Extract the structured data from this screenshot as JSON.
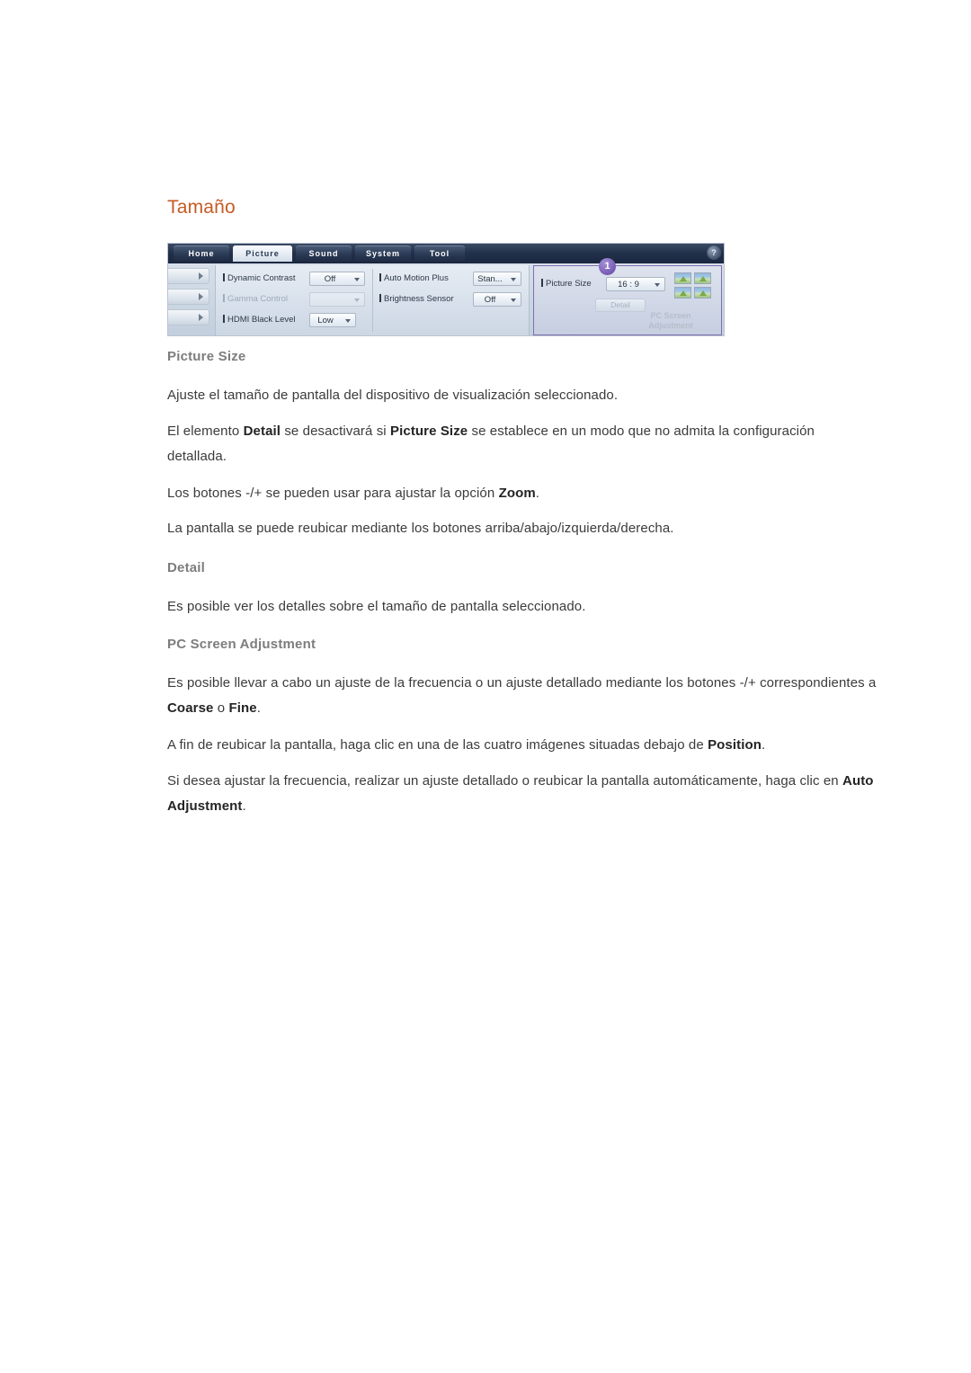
{
  "document": {
    "title": "Tamaño"
  },
  "osd": {
    "tabs": [
      {
        "label": "Home",
        "active": false
      },
      {
        "label": "Picture",
        "active": true
      },
      {
        "label": "Sound",
        "active": false
      },
      {
        "label": "System",
        "active": false
      },
      {
        "label": "Tool",
        "active": false
      }
    ],
    "help_icon": "?",
    "rail_buttons": [
      "chevron-right-icon",
      "chevron-right-icon",
      "chevron-right-icon"
    ],
    "settings_left": [
      {
        "label": "Dynamic Contrast",
        "value": "Off",
        "disabled": false
      },
      {
        "label": "Gamma Control",
        "value": "",
        "disabled": true
      },
      {
        "label": "HDMI Black Level",
        "value": "Low",
        "disabled": false
      }
    ],
    "settings_middle": [
      {
        "label": "Auto Motion Plus",
        "value": "Stan...",
        "disabled": false
      },
      {
        "label": "Brightness Sensor",
        "value": "Off",
        "disabled": false
      }
    ],
    "panel": {
      "badge": "1",
      "picture_size_label": "Picture Size",
      "picture_size_value": "16 : 9",
      "detail_button": "Detail",
      "pc_screen_label": "PC Screen\nAdjustment",
      "pc_screen_line1": "PC Screen",
      "pc_screen_line2": "Adjustment",
      "highlight_color": "#7e6fb0"
    }
  },
  "content": {
    "heading_picture_size": "Picture Size",
    "p_picture_size_1": "Ajuste el tamaño de pantalla del dispositivo de visualización seleccionado.",
    "p_picture_size_2_a": "El elemento ",
    "p_picture_size_2_b": "Detail",
    "p_picture_size_2_c": " se desactivará si ",
    "p_picture_size_2_d": "Picture Size",
    "p_picture_size_2_e": " se establece en un modo que no admita la configuración detallada.",
    "p_picture_size_3_a": "Los botones -/+ se pueden usar para ajustar la opción ",
    "p_picture_size_3_b": "Zoom",
    "p_picture_size_3_c": ".",
    "p_picture_size_4": "La pantalla se puede reubicar mediante los botones arriba/abajo/izquierda/derecha.",
    "heading_detail": "Detail",
    "p_detail_1": "Es posible ver los detalles sobre el tamaño de pantalla seleccionado.",
    "heading_pc_screen_adjustment": "PC Screen Adjustment",
    "p_pcsa_1_a": "Es posible llevar a cabo un ajuste de la frecuencia o un ajuste detallado mediante los botones -/+ correspondientes a ",
    "p_pcsa_1_b": "Coarse",
    "p_pcsa_1_c": " o ",
    "p_pcsa_1_d": "Fine",
    "p_pcsa_1_e": ".",
    "p_pcsa_2_a": "A fin de reubicar la pantalla, haga clic en una de las cuatro imágenes situadas debajo de ",
    "p_pcsa_2_b": "Position",
    "p_pcsa_2_c": ".",
    "p_pcsa_3_a": "Si desea ajustar la frecuencia, realizar un ajuste detallado o reubicar la pantalla automáticamente, haga clic en ",
    "p_pcsa_3_b": "Auto Adjustment",
    "p_pcsa_3_c": "."
  },
  "colors": {
    "title": "#c65a24",
    "subheading": "#7d7d7d",
    "body": "#3b3b3b",
    "tab_active_bg": "#e3eaf2",
    "tab_bg": "#2b3a55",
    "badge": "#7a5fb8"
  }
}
